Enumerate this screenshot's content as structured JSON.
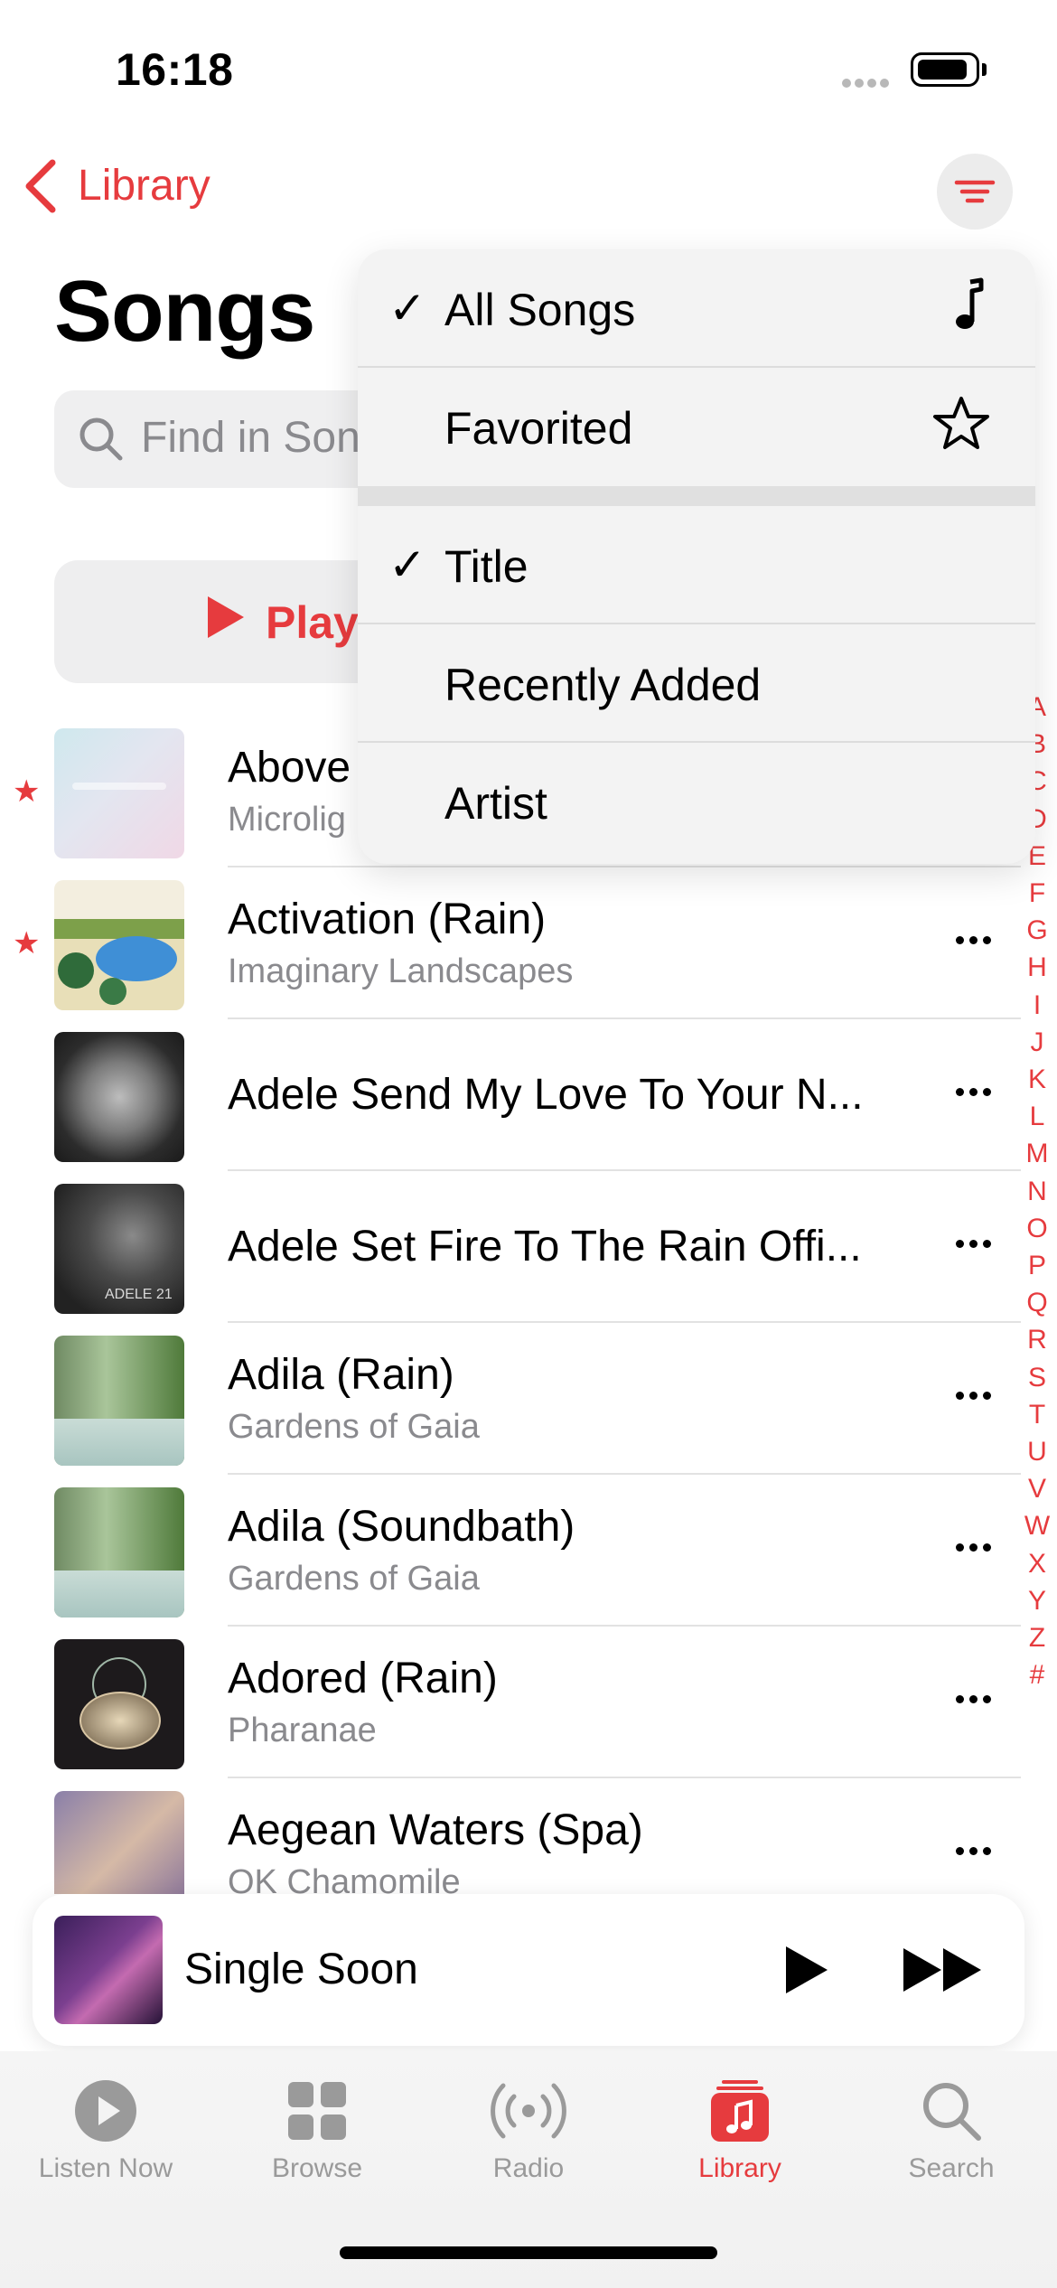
{
  "status_bar": {
    "time": "16:18"
  },
  "nav": {
    "back_label": "Library",
    "sort_icon": "sort-lines-icon"
  },
  "page": {
    "title": "Songs"
  },
  "search": {
    "placeholder": "Find in Songs"
  },
  "play_button": {
    "label": "Play"
  },
  "songs": [
    {
      "title": "Above",
      "subtitle": "Microlig",
      "favorited": true,
      "art": "microlight"
    },
    {
      "title": "Activation (Rain)",
      "subtitle": "Imaginary Landscapes",
      "favorited": true,
      "art": "landscape"
    },
    {
      "title": "Adele  Send My Love To Your N...",
      "subtitle": "",
      "favorited": false,
      "art": "adele25"
    },
    {
      "title": "Adele  Set Fire To The Rain Offi...",
      "subtitle": "",
      "favorited": false,
      "art": "adele21"
    },
    {
      "title": "Adila (Rain)",
      "subtitle": "Gardens of Gaia",
      "favorited": false,
      "art": "gaia"
    },
    {
      "title": "Adila (Soundbath)",
      "subtitle": "Gardens of Gaia",
      "favorited": false,
      "art": "gaia"
    },
    {
      "title": "Adored (Rain)",
      "subtitle": "Pharanae",
      "favorited": false,
      "art": "pharanae"
    },
    {
      "title": "Aegean Waters (Spa)",
      "subtitle": "OK Chamomile",
      "favorited": false,
      "art": "chamomile"
    }
  ],
  "album_art_text": {
    "adele21": "ADELE 21"
  },
  "index_letters": [
    "A",
    "B",
    "C",
    "D",
    "E",
    "F",
    "G",
    "H",
    "I",
    "J",
    "K",
    "L",
    "M",
    "N",
    "O",
    "P",
    "Q",
    "R",
    "S",
    "T",
    "U",
    "V",
    "W",
    "X",
    "Y",
    "Z",
    "#"
  ],
  "menu": {
    "filter_items": [
      {
        "label": "All Songs",
        "checked": true,
        "icon": "music-note-icon"
      },
      {
        "label": "Favorited",
        "checked": false,
        "icon": "star-outline-icon"
      }
    ],
    "sort_items": [
      {
        "label": "Title",
        "checked": true
      },
      {
        "label": "Recently Added",
        "checked": false
      },
      {
        "label": "Artist",
        "checked": false
      }
    ]
  },
  "mini_player": {
    "title": "Single Soon"
  },
  "tabs": [
    {
      "label": "Listen Now",
      "icon": "play-circle-icon",
      "active": false
    },
    {
      "label": "Browse",
      "icon": "grid-icon",
      "active": false
    },
    {
      "label": "Radio",
      "icon": "radio-waves-icon",
      "active": false
    },
    {
      "label": "Library",
      "icon": "music-library-icon",
      "active": true
    },
    {
      "label": "Search",
      "icon": "search-icon",
      "active": false
    }
  ],
  "colors": {
    "accent": "#e63b3e",
    "secondary_text": "#8a8a8e"
  }
}
